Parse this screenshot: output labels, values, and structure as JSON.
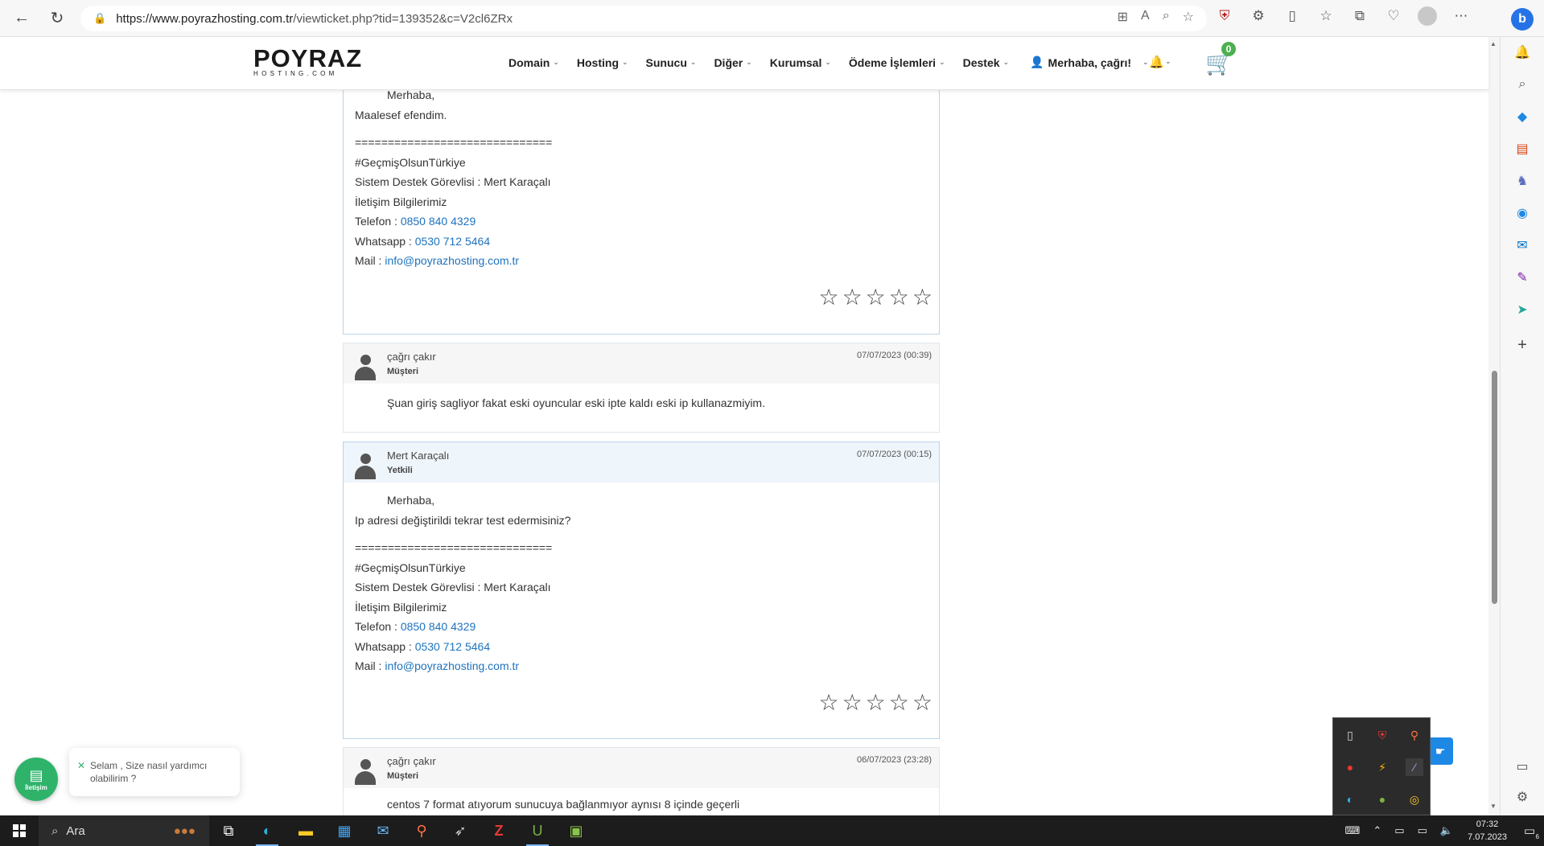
{
  "browser": {
    "url_host": "https://www.poyrazhosting.com.tr",
    "url_path": "/viewticket.php?tid=139352&c=V2cl6ZRx"
  },
  "site": {
    "logo_main": "POYRAZ",
    "logo_sub": "HOSTING.COM",
    "menu": [
      "Domain",
      "Hosting",
      "Sunucu",
      "Diğer",
      "Kurumsal",
      "Ödeme İşlemleri",
      "Destek"
    ],
    "user_greeting": "Merhaba, çağrı!",
    "cart_count": "0",
    "colors": {
      "link": "#1e73be",
      "cart": "#1e88e5",
      "badge": "#4caf50",
      "chat": "#2fb36b"
    }
  },
  "replies": {
    "r1": {
      "greeting": "Merhaba,",
      "message": "Maalesef efendim.",
      "separator": "==============================",
      "sig_tag": "#GeçmişOlsunTürkiye",
      "sig_staff": "Sistem Destek Görevlisi : Mert Karaçalı",
      "sig_contact": "İletişim Bilgilerimiz",
      "phone_label": "Telefon : ",
      "phone": "0850 840 4329",
      "whatsapp_label": "Whatsapp : ",
      "whatsapp": "0530 712 5464",
      "mail_label": "Mail : ",
      "mail": "info@poyrazhosting.com.tr"
    },
    "r2": {
      "name": "çağrı çakır",
      "role": "Müşteri",
      "date": "07/07/2023 (00:39)",
      "message": "Şuan giriş sagliyor fakat eski oyuncular eski ipte kaldı eski ip kullanazmiyim."
    },
    "r3": {
      "name": "Mert Karaçalı",
      "role": "Yetkili",
      "date": "07/07/2023 (00:15)",
      "greeting": "Merhaba,",
      "message": "Ip adresi değiştirildi tekrar test edermisiniz?",
      "separator": "==============================",
      "sig_tag": "#GeçmişOlsunTürkiye",
      "sig_staff": "Sistem Destek Görevlisi : Mert Karaçalı",
      "sig_contact": "İletişim Bilgilerimiz",
      "phone_label": "Telefon : ",
      "phone": "0850 840 4329",
      "whatsapp_label": "Whatsapp : ",
      "whatsapp": "0530 712 5464",
      "mail_label": "Mail : ",
      "mail": "info@poyrazhosting.com.tr"
    },
    "r4": {
      "name": "çağrı çakır",
      "role": "Müşteri",
      "date": "06/07/2023 (23:28)",
      "message": "centos 7 format atıyorum sunucuya bağlanmıyor aynısı 8 içinde geçerli"
    }
  },
  "chat": {
    "label": "İletişim",
    "bubble": "Selam , Size nasıl yardımcı olabilirim ?"
  },
  "taskbar": {
    "search": "Ara",
    "time": "07:32",
    "date": "7.07.2023",
    "notifications": "6"
  }
}
